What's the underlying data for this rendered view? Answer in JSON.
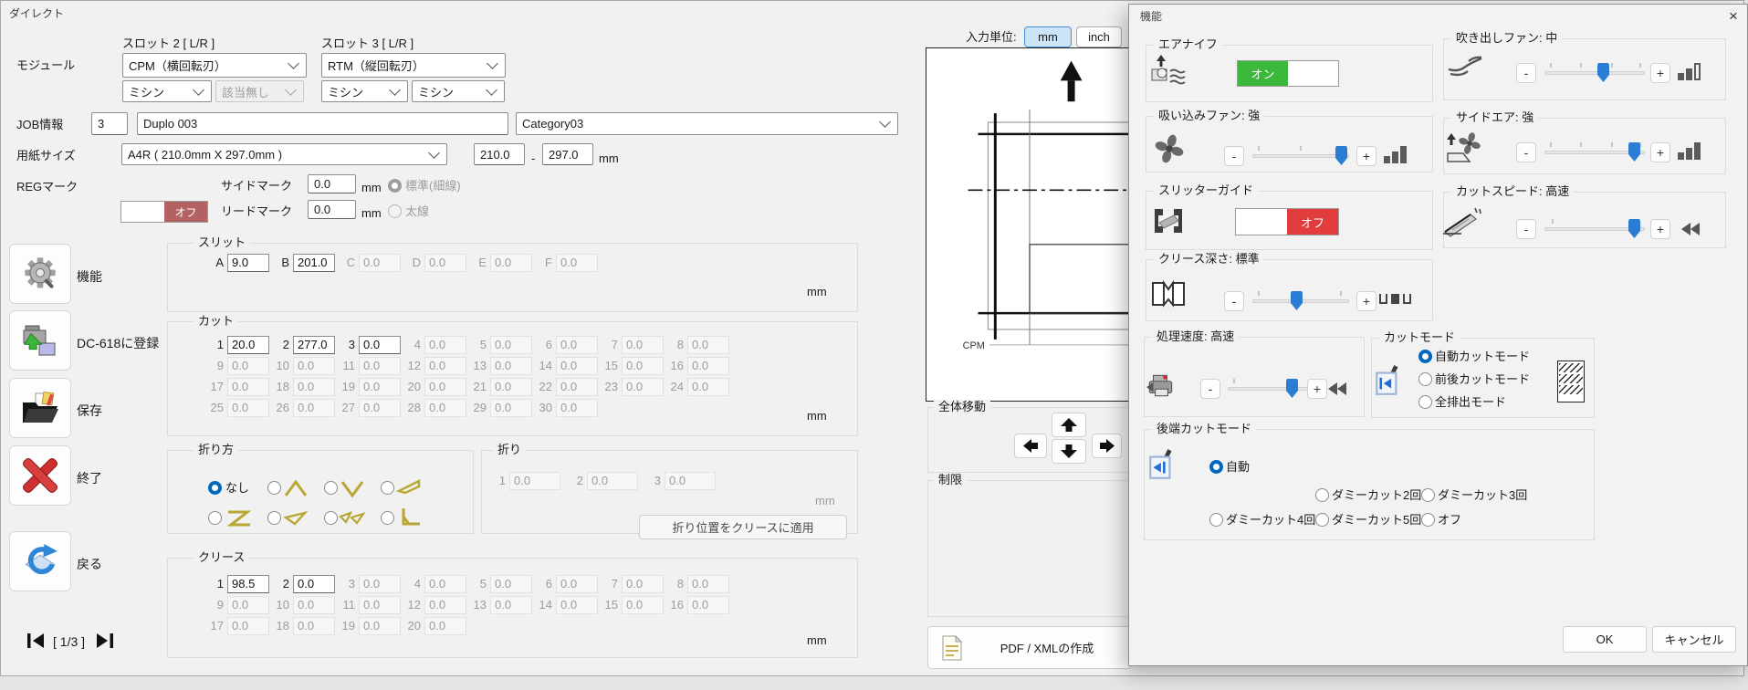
{
  "window": {
    "title": "ダイレクト"
  },
  "module": {
    "label": "モジュール",
    "slot2_label": "スロット 2 [ L/R ]",
    "slot3_label": "スロット 3 [ L/R ]",
    "slot2_main": "CPM（横回転刃）",
    "slot3_main": "RTM（縦回転刃）",
    "slot2_sub1": "ミシン",
    "slot2_sub2": "該当無し",
    "slot3_sub1": "ミシン",
    "slot3_sub2": "ミシン"
  },
  "job": {
    "label": "JOB情報",
    "number": "3",
    "name": "Duplo 003",
    "category": "Category03"
  },
  "paper": {
    "label": "用紙サイズ",
    "size": "A4R ( 210.0mm X 297.0mm )",
    "width": "210.0",
    "sep": "-",
    "height": "297.0",
    "unit": "mm"
  },
  "regmark": {
    "label": "REGマーク",
    "off": "オフ",
    "side_label": "サイドマーク",
    "side_value": "0.0",
    "lead_label": "リードマーク",
    "lead_value": "0.0",
    "unit": "mm",
    "standard": "標準(細線)",
    "bold": "太線"
  },
  "slit": {
    "title": "スリット",
    "unit": "mm",
    "items": [
      {
        "k": "A",
        "v": "9.0",
        "active": true
      },
      {
        "k": "B",
        "v": "201.0",
        "active": true
      },
      {
        "k": "C",
        "v": "0.0",
        "active": false
      },
      {
        "k": "D",
        "v": "0.0",
        "active": false
      },
      {
        "k": "E",
        "v": "0.0",
        "active": false
      },
      {
        "k": "F",
        "v": "0.0",
        "active": false
      }
    ]
  },
  "cut": {
    "title": "カット",
    "unit": "mm",
    "items": [
      {
        "k": "1",
        "v": "20.0",
        "active": true
      },
      {
        "k": "2",
        "v": "277.0",
        "active": true
      },
      {
        "k": "3",
        "v": "0.0",
        "active": true
      },
      {
        "k": "4",
        "v": "0.0",
        "active": false
      },
      {
        "k": "5",
        "v": "0.0",
        "active": false
      },
      {
        "k": "6",
        "v": "0.0",
        "active": false
      },
      {
        "k": "7",
        "v": "0.0",
        "active": false
      },
      {
        "k": "8",
        "v": "0.0",
        "active": false
      },
      {
        "k": "9",
        "v": "0.0",
        "active": false
      },
      {
        "k": "10",
        "v": "0.0",
        "active": false
      },
      {
        "k": "11",
        "v": "0.0",
        "active": false
      },
      {
        "k": "12",
        "v": "0.0",
        "active": false
      },
      {
        "k": "13",
        "v": "0.0",
        "active": false
      },
      {
        "k": "14",
        "v": "0.0",
        "active": false
      },
      {
        "k": "15",
        "v": "0.0",
        "active": false
      },
      {
        "k": "16",
        "v": "0.0",
        "active": false
      },
      {
        "k": "17",
        "v": "0.0",
        "active": false
      },
      {
        "k": "18",
        "v": "0.0",
        "active": false
      },
      {
        "k": "19",
        "v": "0.0",
        "active": false
      },
      {
        "k": "20",
        "v": "0.0",
        "active": false
      },
      {
        "k": "21",
        "v": "0.0",
        "active": false
      },
      {
        "k": "22",
        "v": "0.0",
        "active": false
      },
      {
        "k": "23",
        "v": "0.0",
        "active": false
      },
      {
        "k": "24",
        "v": "0.0",
        "active": false
      },
      {
        "k": "25",
        "v": "0.0",
        "active": false
      },
      {
        "k": "26",
        "v": "0.0",
        "active": false
      },
      {
        "k": "27",
        "v": "0.0",
        "active": false
      },
      {
        "k": "28",
        "v": "0.0",
        "active": false
      },
      {
        "k": "29",
        "v": "0.0",
        "active": false
      },
      {
        "k": "30",
        "v": "0.0",
        "active": false
      }
    ]
  },
  "fold_type": {
    "title": "折り方",
    "none": "なし"
  },
  "fold": {
    "title": "折り",
    "unit": "mm",
    "apply": "折り位置をクリースに適用",
    "items": [
      {
        "k": "1",
        "v": "0.0",
        "active": false
      },
      {
        "k": "2",
        "v": "0.0",
        "active": false
      },
      {
        "k": "3",
        "v": "0.0",
        "active": false
      }
    ]
  },
  "crease": {
    "title": "クリース",
    "unit": "mm",
    "items": [
      {
        "k": "1",
        "v": "98.5",
        "active": true
      },
      {
        "k": "2",
        "v": "0.0",
        "active": true
      },
      {
        "k": "3",
        "v": "0.0",
        "active": false
      },
      {
        "k": "4",
        "v": "0.0",
        "active": false
      },
      {
        "k": "5",
        "v": "0.0",
        "active": false
      },
      {
        "k": "6",
        "v": "0.0",
        "active": false
      },
      {
        "k": "7",
        "v": "0.0",
        "active": false
      },
      {
        "k": "8",
        "v": "0.0",
        "active": false
      },
      {
        "k": "9",
        "v": "0.0",
        "active": false
      },
      {
        "k": "10",
        "v": "0.0",
        "active": false
      },
      {
        "k": "11",
        "v": "0.0",
        "active": false
      },
      {
        "k": "12",
        "v": "0.0",
        "active": false
      },
      {
        "k": "13",
        "v": "0.0",
        "active": false
      },
      {
        "k": "14",
        "v": "0.0",
        "active": false
      },
      {
        "k": "15",
        "v": "0.0",
        "active": false
      },
      {
        "k": "16",
        "v": "0.0",
        "active": false
      },
      {
        "k": "17",
        "v": "0.0",
        "active": false
      },
      {
        "k": "18",
        "v": "0.0",
        "active": false
      },
      {
        "k": "19",
        "v": "0.0",
        "active": false
      },
      {
        "k": "20",
        "v": "0.0",
        "active": false
      }
    ]
  },
  "sidebar": {
    "items": [
      {
        "label": "機能"
      },
      {
        "label": "DC-618に登録"
      },
      {
        "label": "保存"
      },
      {
        "label": "終了"
      },
      {
        "label": "戻る"
      }
    ],
    "page": "[ 1/3 ]"
  },
  "units": {
    "label": "入力単位:",
    "mm": "mm",
    "inch": "inch"
  },
  "preview": {
    "cpm": "CPM"
  },
  "move": {
    "title": "全体移動"
  },
  "limit": {
    "title": "制限"
  },
  "pdf": {
    "label": "PDF / XMLの作成"
  },
  "controls": {
    "minus": "-",
    "plus": "+"
  },
  "dialog": {
    "title": "機能",
    "close": "×",
    "air_knife": {
      "title": "エアナイフ",
      "on": "オン"
    },
    "suction_fan": {
      "title": "吸い込みファン: 強"
    },
    "slitter_guide": {
      "title": "スリッターガイド",
      "off": "オフ"
    },
    "crease_depth": {
      "title": "クリース深さ: 標準"
    },
    "process_speed": {
      "title": "処理速度: 高速"
    },
    "blow_fan": {
      "title": "吹き出しファン: 中"
    },
    "side_air": {
      "title": "サイドエア: 強"
    },
    "cut_speed": {
      "title": "カットスピード: 高速"
    },
    "cut_mode": {
      "title": "カットモード",
      "options": [
        "自動カットモード",
        "前後カットモード",
        "全排出モード"
      ],
      "selected": "自動カットモード"
    },
    "tail_cut": {
      "title": "後端カットモード",
      "auto": "自動",
      "row2": [
        "ダミーカット2回",
        "ダミーカット3回"
      ],
      "row3": [
        "ダミーカット4回",
        "ダミーカット5回",
        "オフ"
      ],
      "selected": "自動"
    },
    "ok": "OK",
    "cancel": "キャンセル"
  },
  "colors": {
    "accent_blue": "#0067c0",
    "toggle_green": "#3cb93c",
    "toggle_red": "#e23d3d",
    "regmark_red": "#b26262",
    "fold_icon_gold": "#b9a733"
  }
}
